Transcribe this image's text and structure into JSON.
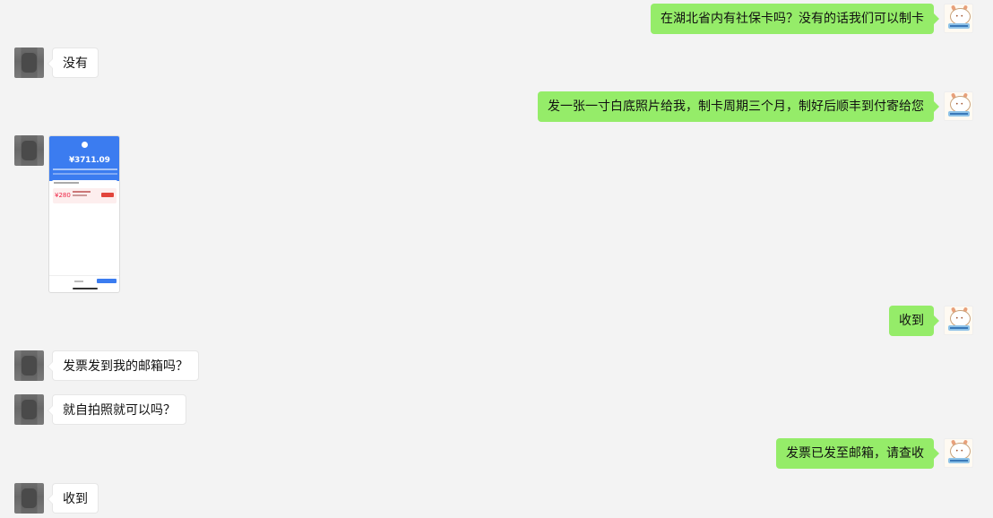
{
  "messages": [
    {
      "side": "right",
      "type": "text",
      "text": "在湖北省内有社保卡吗？没有的话我们可以制卡"
    },
    {
      "side": "left",
      "type": "text",
      "text": "没有"
    },
    {
      "side": "right",
      "type": "text",
      "text": "发一张一寸白底照片给我，制卡周期三个月，制好后顺丰到付寄给您"
    },
    {
      "side": "left",
      "type": "image",
      "image": {
        "amount": "¥3711.09",
        "coupon_price": "¥280"
      }
    },
    {
      "side": "right",
      "type": "text",
      "text": "收到"
    },
    {
      "side": "left",
      "type": "text",
      "text": "发票发到我的邮箱吗？"
    },
    {
      "side": "left",
      "type": "text",
      "text": "就自拍照就可以吗？"
    },
    {
      "side": "right",
      "type": "text",
      "text": "发票已发至邮箱，请查收"
    },
    {
      "side": "left",
      "type": "text",
      "text": "收到"
    }
  ],
  "colors": {
    "sent_bubble": "#95ec69",
    "received_bubble": "#ffffff",
    "background": "#f3f3f3"
  }
}
